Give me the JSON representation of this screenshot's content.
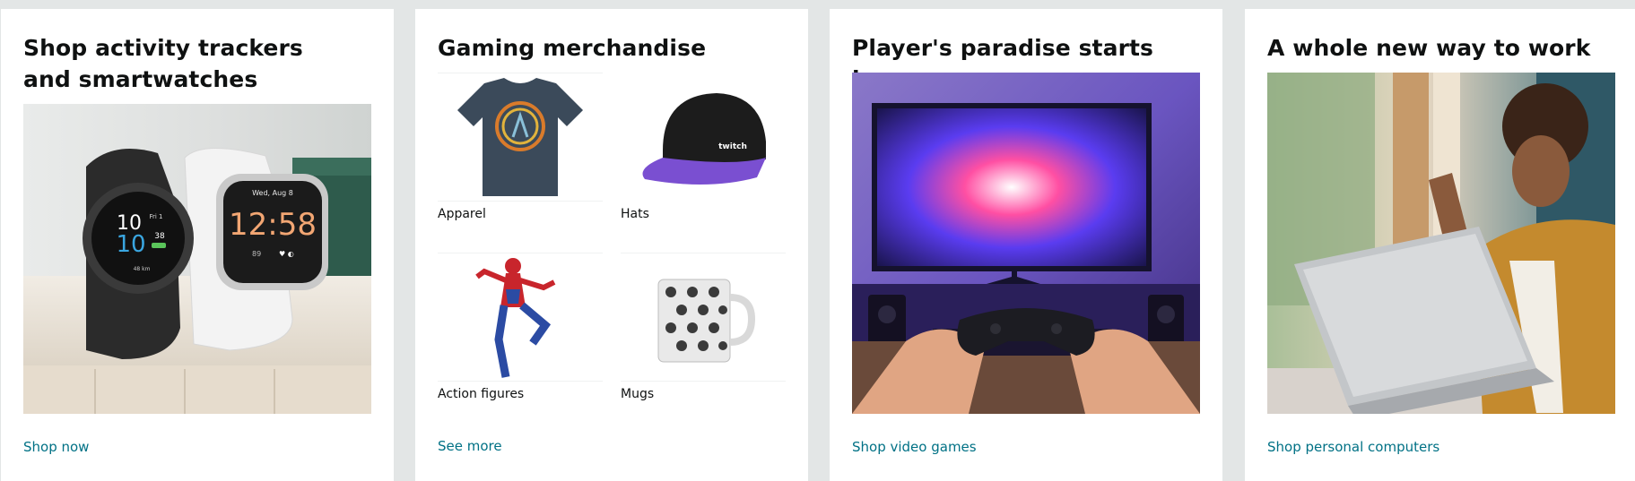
{
  "cards": [
    {
      "title": "Shop activity trackers and smartwatches",
      "link": "Shop now",
      "image": "smartwatches-image",
      "watch_dark": {
        "time_small": "10",
        "date": "Fri 1",
        "time_big": "10",
        "secs": "38",
        "distance": "48 km"
      },
      "watch_light": {
        "date": "Wed, Aug 8",
        "time": "12:58",
        "steps": "89"
      }
    },
    {
      "title": "Gaming merchandise",
      "tiles": [
        {
          "label": "Apparel",
          "icon": "tshirt-image"
        },
        {
          "label": "Hats",
          "icon": "cap-image",
          "brand": "twitch"
        },
        {
          "label": "Action figures",
          "icon": "action-figure-image"
        },
        {
          "label": "Mugs",
          "icon": "mug-image"
        }
      ],
      "link": "See more"
    },
    {
      "title": "Player's paradise starts here",
      "link": "Shop video games",
      "image": "gaming-setup-image"
    },
    {
      "title": "A whole new way to work",
      "link": "Shop personal computers",
      "image": "laptop-work-image"
    }
  ],
  "colors": {
    "page_bg": "#e3e6e6",
    "card_bg": "#ffffff",
    "title": "#0f1111",
    "link": "#007185"
  }
}
